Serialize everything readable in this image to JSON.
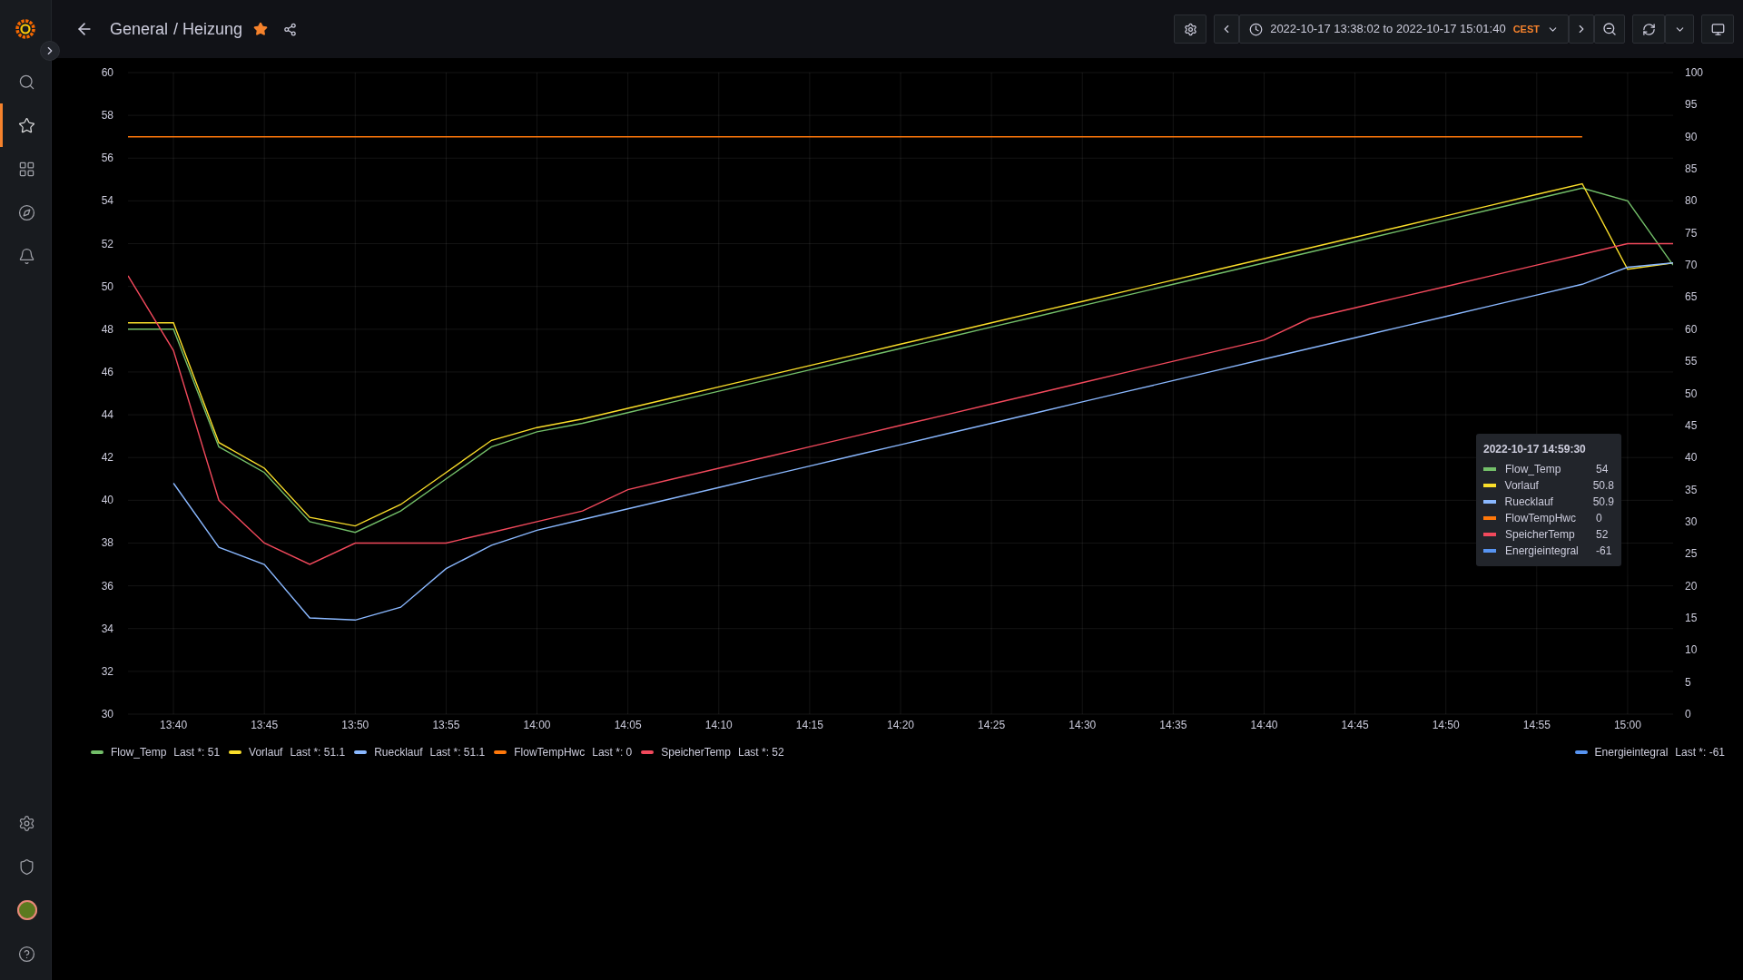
{
  "sidebar": {
    "top_items": [
      {
        "selected": false
      },
      {
        "selected": true
      },
      {
        "selected": false
      },
      {
        "selected": false
      },
      {
        "selected": false
      }
    ],
    "bottom_items": [
      {
        "selected": false
      },
      {
        "selected": false
      },
      {
        "selected": false
      },
      {
        "selected": false
      }
    ]
  },
  "topbar": {
    "breadcrumb": [
      "General",
      "/ Heizung"
    ],
    "starred": true,
    "time_range": "2022-10-17 13:38:02 to 2022-10-17 15:01:40",
    "timezone": "CEST"
  },
  "panel": {
    "chart_data": {
      "type": "line",
      "categories": [
        null,
        "13:40",
        null,
        "13:45",
        null,
        "13:50",
        null,
        "13:55",
        null,
        "14:00",
        null,
        "14:05",
        null,
        "14:10",
        null,
        "14:15",
        null,
        "14:20",
        null,
        "14:25",
        null,
        "14:30",
        null,
        "14:35",
        null,
        "14:40",
        null,
        "14:45",
        null,
        "14:50",
        null,
        "14:55",
        null,
        "15:00",
        null
      ],
      "ylim": [
        30,
        60
      ],
      "yticks": [
        30,
        32,
        34,
        36,
        38,
        40,
        42,
        44,
        46,
        48,
        50,
        52,
        54,
        56,
        58,
        60
      ],
      "series": [
        {
          "name": "Flow_Temp",
          "color": "#73bf69",
          "values": [
            48,
            48,
            42.5,
            41.3,
            39,
            38.5,
            39.5,
            41,
            42.5,
            43.2,
            43.6,
            44.1,
            44.6,
            45.1,
            45.6,
            46.1,
            46.6,
            47.1,
            47.6,
            48.1,
            48.6,
            49.1,
            49.6,
            50.1,
            50.6,
            51.1,
            51.6,
            52.1,
            52.6,
            53.1,
            53.6,
            54.1,
            54.6,
            54,
            51
          ]
        },
        {
          "name": "Vorlauf",
          "color": "#fade2a",
          "values": [
            48.3,
            48.3,
            42.7,
            41.5,
            39.2,
            38.8,
            39.8,
            41.3,
            42.8,
            43.4,
            43.8,
            44.3,
            44.8,
            45.3,
            45.8,
            46.3,
            46.8,
            47.3,
            47.8,
            48.3,
            48.8,
            49.3,
            49.8,
            50.3,
            50.8,
            51.3,
            51.8,
            52.3,
            52.8,
            53.3,
            53.8,
            54.3,
            54.8,
            50.8,
            51.1
          ]
        },
        {
          "name": "Ruecklauf",
          "color": "#8ab8ff",
          "values": [
            null,
            40.8,
            37.8,
            37,
            34.5,
            34.4,
            35,
            36.8,
            37.9,
            38.6,
            39.1,
            39.6,
            40.1,
            40.6,
            41.1,
            41.6,
            42.1,
            42.6,
            43.1,
            43.6,
            44.1,
            44.6,
            45.1,
            45.6,
            46.1,
            46.6,
            47.1,
            47.6,
            48.1,
            48.6,
            49.1,
            49.6,
            50.1,
            50.9,
            51.1
          ]
        },
        {
          "name": "FlowTempHwc",
          "color": "#ff780a",
          "values": [
            57,
            57,
            57,
            57,
            57,
            57,
            57,
            57,
            57,
            57,
            57,
            57,
            57,
            57,
            57,
            57,
            57,
            57,
            57,
            57,
            57,
            57,
            57,
            57,
            57,
            57,
            57,
            57,
            57,
            57,
            57,
            57,
            57,
            null,
            null
          ]
        },
        {
          "name": "SpeicherTemp",
          "color": "#f2495c",
          "values": [
            50.5,
            47,
            40,
            38,
            37,
            38,
            38,
            38,
            38.5,
            39,
            39.5,
            40.5,
            41,
            41.5,
            42,
            42.5,
            43,
            43.5,
            44,
            44.5,
            45,
            45.5,
            46,
            46.5,
            47,
            47.5,
            48.5,
            49,
            49.5,
            50,
            50.5,
            51,
            51.5,
            52,
            52
          ]
        },
        {
          "name": "Energieintegral",
          "color": "#5794f2",
          "values": [
            null,
            null,
            null,
            null,
            null,
            null,
            null,
            null,
            null,
            null,
            null,
            null,
            null,
            null,
            null,
            null,
            null,
            null,
            null,
            null,
            null,
            null,
            null,
            null,
            null,
            null,
            null,
            null,
            null,
            null,
            null,
            null,
            null,
            null,
            null
          ]
        }
      ],
      "grid": true
    },
    "right_axis_ticks": [
      "100",
      "95",
      "90",
      "85",
      "80",
      "75",
      "70",
      "65",
      "60",
      "55",
      "50",
      "45",
      "40",
      "35",
      "30",
      "25",
      "20",
      "15",
      "10",
      "5",
      "0"
    ],
    "tooltip": {
      "time": "2022-10-17 14:59:30",
      "rows": [
        {
          "name": "Flow_Temp",
          "value": "54",
          "color": "#73bf69"
        },
        {
          "name": "Vorlauf",
          "value": "50.8",
          "color": "#fade2a"
        },
        {
          "name": "Ruecklauf",
          "value": "50.9",
          "color": "#8ab8ff"
        },
        {
          "name": "FlowTempHwc",
          "value": "0",
          "color": "#ff780a"
        },
        {
          "name": "SpeicherTemp",
          "value": "52",
          "color": "#f2495c"
        },
        {
          "name": "Energieintegral",
          "value": "-61",
          "color": "#5794f2"
        }
      ]
    },
    "legend_left_readings": [
      "Last *: 51",
      "Last *: 51.1",
      "Last *: 51.1",
      "Last *: 0",
      "Last *: 52"
    ],
    "legend_right_readings": [
      "Last *: -61"
    ]
  }
}
